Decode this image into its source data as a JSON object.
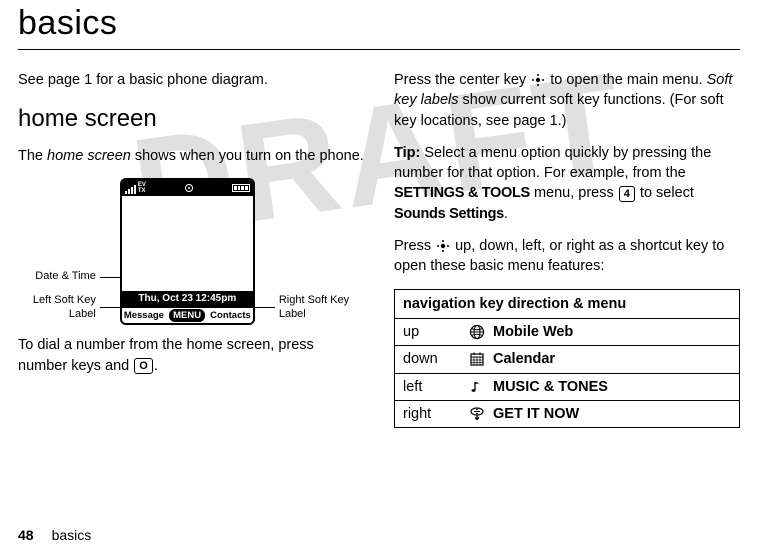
{
  "title": "basics",
  "left": {
    "intro": "See page 1 for a basic phone diagram.",
    "sub": "home screen",
    "para1_a": "The ",
    "para1_ital": "home screen",
    "para1_b": " shows when you turn on the phone.",
    "para2_a": "To dial a number from the home screen, press number keys and ",
    "para2_key": "O",
    "para2_b": ".",
    "callouts": {
      "datetime": "Date & Time",
      "leftsoft1": "Left Soft Key",
      "leftsoft2": "Label",
      "rightsoft1": "Right Soft Key",
      "rightsoft2": "Label"
    },
    "phone": {
      "ev": "EV",
      "tx": "TX",
      "datetime": "Thu, Oct 23 12:45pm",
      "left": "Message",
      "mid": "MENU",
      "right": "Contacts"
    }
  },
  "right": {
    "p1_a": "Press the center key ",
    "p1_b": " to open the main menu. ",
    "p1_ital": "Soft key labels",
    "p1_c": " show current soft key functions. (For soft key locations, see page 1.)",
    "tip_label": "Tip:",
    "tip_a": " Select a menu option quickly by pressing the number for that option. For example, from the ",
    "tip_menu": "SETTINGS & TOOLS",
    "tip_b": " menu, press ",
    "tip_key": "4",
    "tip_c": " to select ",
    "tip_opt": "Sounds Settings",
    "tip_d": ".",
    "p3_a": "Press ",
    "p3_b": " up, down, left, or right as a shortcut key to open these basic menu features:"
  },
  "table": {
    "header": "navigation key direction & menu",
    "rows": [
      {
        "dir": "up",
        "label": "Mobile Web"
      },
      {
        "dir": "down",
        "label": "Calendar"
      },
      {
        "dir": "left",
        "label": "MUSIC & TONES"
      },
      {
        "dir": "right",
        "label": "GET IT NOW"
      }
    ]
  },
  "footer": {
    "page": "48",
    "section": "basics"
  }
}
